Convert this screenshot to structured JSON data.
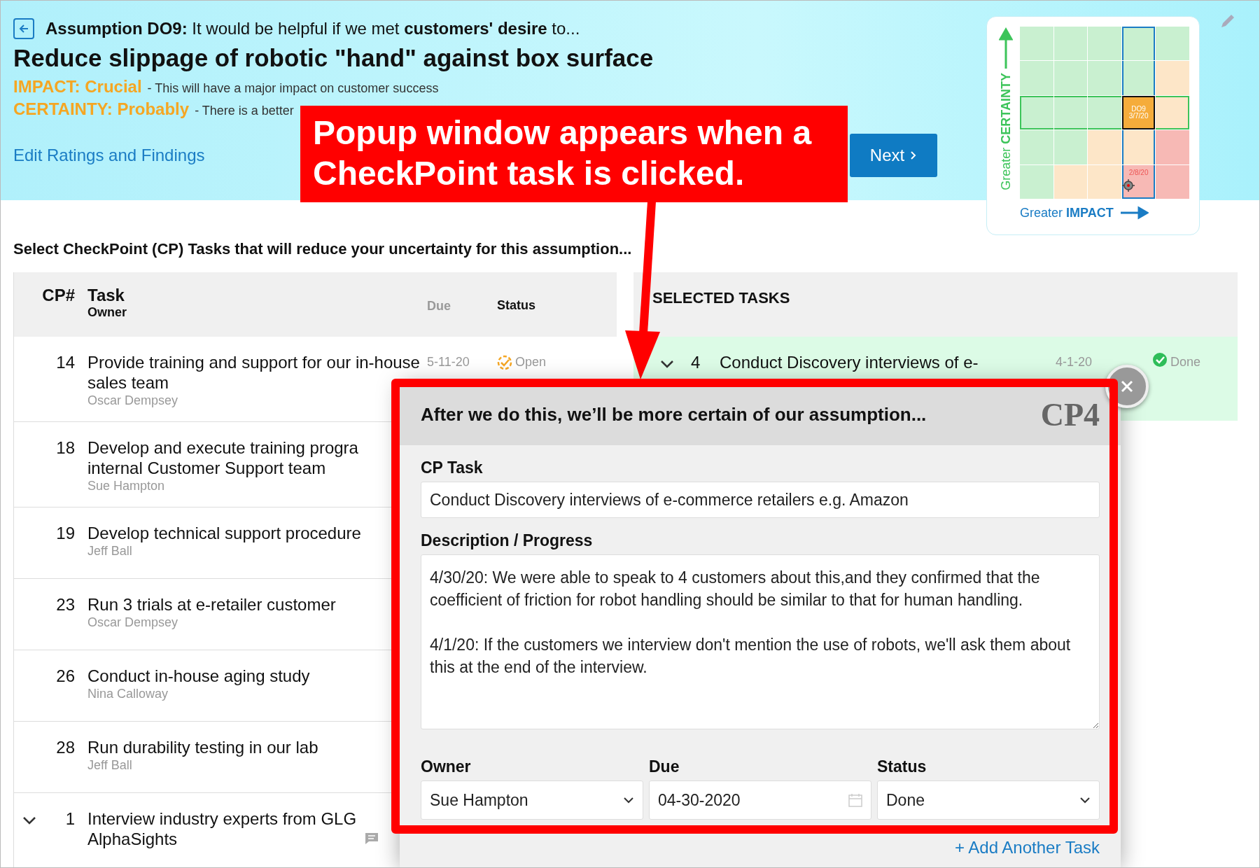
{
  "header": {
    "intro": "**Assumption DO9:** It would be helpful if we met **customers' desire** to...",
    "title": "Reduce slippage of robotic \"hand\" against box surface",
    "ratings": [
      {
        "label": "IMPACT: Crucial",
        "text": "- This will have a major impact on customer success"
      },
      {
        "label": "CERTAINTY: Probably",
        "text": "- There is a better"
      }
    ],
    "edit_link": "Edit Ratings and Findings",
    "next_button": "Next"
  },
  "matrix": {
    "y_label": "Greater **CERTAINTY**",
    "x_label": "Greater **IMPACT**",
    "current": {
      "label": "DO9",
      "date": "3/7/20"
    },
    "previous": {
      "date": "2/8/20"
    }
  },
  "prompt": "Select CheckPoint (CP) Tasks that will reduce your uncertainty for this assumption...",
  "tasks_table": {
    "columns": [
      "CP#",
      "Task",
      "Owner",
      "Due",
      "Status"
    ],
    "rows": [
      {
        "kind": "task",
        "cp": "14",
        "task": "Provide training and support for our in-house sales team",
        "owner": "Oscar Dempsey",
        "due": "5-11-20",
        "status": "Open",
        "has_comment": false
      },
      {
        "kind": "task",
        "cp": "18",
        "task": "Develop and execute training progra\ninternal Customer Support team",
        "owner": "Sue Hampton",
        "has_comment": false
      },
      {
        "kind": "task",
        "cp": "19",
        "task": "Develop technical support procedure",
        "owner": "Jeff Ball",
        "has_comment": false
      },
      {
        "kind": "task",
        "cp": "23",
        "task": "Run 3 trials at e-retailer customer",
        "owner": "Oscar Dempsey",
        "has_comment": false
      },
      {
        "kind": "task",
        "cp": "26",
        "task": "Conduct in-house aging study",
        "owner": "Nina Calloway",
        "has_comment": false
      },
      {
        "kind": "task",
        "cp": "28",
        "task": "Run durability testing in our lab",
        "owner": "Jeff Ball",
        "has_comment": false
      },
      {
        "kind": "expandable",
        "cp": "1",
        "task": "Interview industry experts from GLG\nAlphaSights",
        "has_comment": true
      }
    ]
  },
  "selected_tasks": {
    "title": "SELECTED TASKS",
    "rows": [
      {
        "kind": "expandable",
        "cp": "4",
        "task": "Conduct Discovery interviews of e-",
        "due": "4-1-20",
        "status": "Done"
      }
    ]
  },
  "popup": {
    "heading": "After we do this, we’ll be more certain of our assumption...",
    "badge": "CP4",
    "task_label": "CP Task",
    "task_value": "Conduct Discovery interviews of e-commerce retailers e.g. Amazon",
    "description_label": "Description / Progress",
    "description_value": "4/30/20: We were able to speak to 4 customers about this,and they confirmed that the coefficient of friction for robot handling should be similar to that for human handling.\n\n4/1/20: If the customers we interview don't mention the use of robots, we'll ask them about this at the end of the interview.",
    "owner_label": "Owner",
    "owner_value": "Sue Hampton",
    "due_label": "Due",
    "due_value": "04-30-2020",
    "status_label": "Status",
    "status_value": "Done",
    "add_link": "+ Add Another Task"
  },
  "callout": {
    "text": "Popup window appears when a CheckPoint task is clicked."
  }
}
